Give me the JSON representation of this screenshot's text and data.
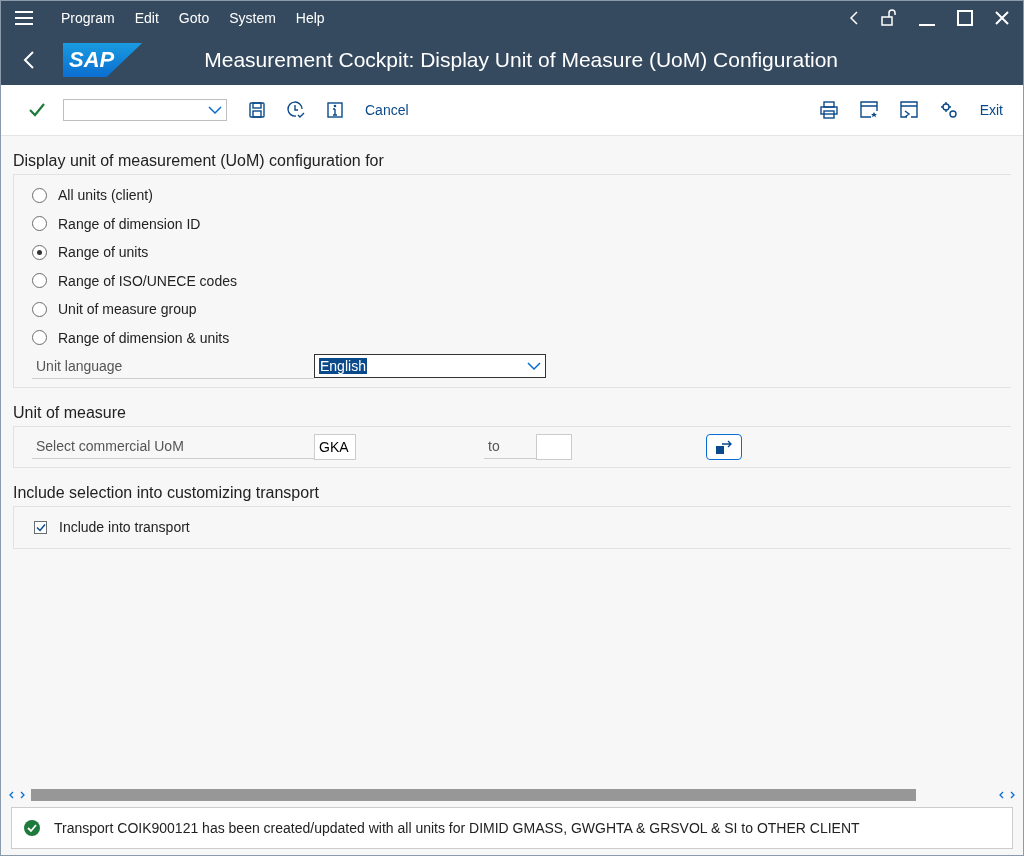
{
  "menu": [
    {
      "label": "Program"
    },
    {
      "label": "Edit"
    },
    {
      "label": "Goto"
    },
    {
      "label": "System"
    },
    {
      "label": "Help"
    }
  ],
  "header": {
    "logo": "SAP",
    "title": "Measurement Cockpit: Display Unit of Measure (UoM) Configuration"
  },
  "toolbar": {
    "cancel": "Cancel",
    "exit": "Exit"
  },
  "sections": [
    {
      "title": "Display unit of measurement (UoM) configuration for",
      "rows": [
        {
          "kind": "radio",
          "label": "All units (client)",
          "selected": false
        },
        {
          "kind": "radio",
          "label": "Range of dimension ID",
          "selected": false
        },
        {
          "kind": "radio",
          "label": "Range of units",
          "selected": true
        },
        {
          "kind": "radio",
          "label": "Range of ISO/UNECE codes",
          "selected": false
        },
        {
          "kind": "radio",
          "label": "Unit of measure group",
          "selected": false
        },
        {
          "kind": "radio",
          "label": "Range of dimension & units",
          "selected": false
        },
        {
          "kind": "dropdown",
          "label": "Unit language",
          "value": "English"
        }
      ]
    },
    {
      "title": "Unit of measure",
      "rows": [
        {
          "kind": "range",
          "label": "Select commercial UoM",
          "from": "GKA",
          "to_label": "to"
        }
      ]
    },
    {
      "title": "Include selection into customizing transport",
      "rows": [
        {
          "kind": "checkbox",
          "label": "Include into transport",
          "checked": true
        }
      ]
    }
  ],
  "status": {
    "message": "Transport COIK900121 has been created/updated with all units for DIMID GMASS, GWGHTA & GRSVOL & SI to OTHER CLIENT"
  }
}
